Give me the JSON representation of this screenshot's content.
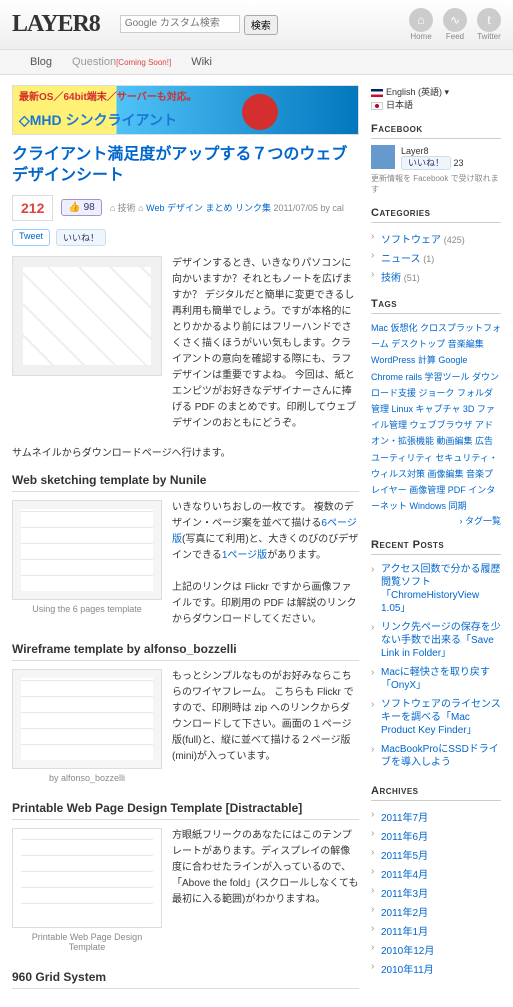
{
  "header": {
    "logo": "LAYER8",
    "search_placeholder": "Google カスタム検索",
    "search_btn": "検索",
    "icons": [
      {
        "name": "home-icon",
        "label": "Home",
        "glyph": "⌂"
      },
      {
        "name": "feed-icon",
        "label": "Feed",
        "glyph": "∿"
      },
      {
        "name": "twitter-icon",
        "label": "Twitter",
        "glyph": "t"
      }
    ]
  },
  "nav": {
    "blog": "Blog",
    "question": "Question",
    "coming_soon": "[Coming Soon!]",
    "wiki": "Wiki"
  },
  "banner": {
    "line1": "最新OS／64bit端末／サーバーも対応。",
    "line2": "◇MHD シンクライアント"
  },
  "article": {
    "title": "クライアント満足度がアップする７つのウェブデザインシート",
    "count": "212",
    "like_count": "98",
    "like_icon_label": "👍",
    "meta_prefix": "⌂ 技術 ⌂",
    "meta_link": "Web デザイン まとめ リンク集",
    "meta_date": "2011/07/05 by cal",
    "tweet": "Tweet",
    "iine": "いいね！",
    "intro": "デザインするとき、いきなりパソコンに向かいますか？それともノートを広げますか？\nデジタルだと簡単に変更できるし再利用も簡単でしょう。ですが本格的にとりかかるより前にはフリーハンドでさくさく描くほうがいい気もします。クライアントの意向を確認する際にも、ラフデザインは重要ですよね。\n今回は、紙とエンピツがお好きなデザイナーさんに捧げる PDF のまとめです。印刷してウェブデザインのおともにどうぞ。",
    "thumbnail_note": "サムネイルからダウンロードページへ行けます。"
  },
  "sections": [
    {
      "heading": "Web sketching template by Nunile",
      "caption": "Using the 6 pages template",
      "body1": "いきなりいちおしの一枚です。\n複数のデザイン・ページ案を並べて描ける",
      "link1": "6ページ版",
      "body2": "(写真にて利用)と、大きくのびのびデザインできる",
      "link2": "1ページ版",
      "body3": "があります。",
      "body4": "上記のリンクは Flickr ですから画像ファイルです。印刷用の PDF は解説のリンクからダウンロードしてください。"
    },
    {
      "heading": "Wireframe template by alfonso_bozzelli",
      "caption": "by alfonso_bozzelli",
      "body1": "もっとシンプルなものがお好みならこちらのワイヤフレーム。\nこちらも Flickr ですので、印刷時は zip へのリンクからダウンロードして下さい。画面の１ページ版(full)と、縦に並べて描ける２ページ版(mini)が入っています。"
    },
    {
      "heading": "Printable Web Page Design Template [Distractable]",
      "caption": "Printable Web Page Design Template",
      "body1": "方眼紙フリークのあなたにはこのテンプレートがあります。ディスプレイの解像度に合わせたラインが入っているので、「Above the fold」(スクロールしなくても最初に入る範囲)がわかりますね。"
    },
    {
      "heading": "960 Grid System",
      "caption": "",
      "body1": ""
    }
  ],
  "sidebar": {
    "lang_en": "English (英語)",
    "lang_jp": "日本語",
    "fb_h": "Facebook",
    "fb_name": "Layer8",
    "fb_like": "いいね！",
    "fb_count": "23",
    "fb_sub": "更新情報を Facebook で受け取れます",
    "cat_h": "Categories",
    "cats": [
      {
        "label": "ソフトウェア",
        "count": "(425)"
      },
      {
        "label": "ニュース",
        "count": "(1)"
      },
      {
        "label": "技術",
        "count": "(51)"
      }
    ],
    "tag_h": "Tags",
    "tags_html": "Mac 仮想化 クロスプラットフォーム デスクトップ 音楽編集 WordPress 計算 Google Chrome rails 学習ツール ダウンロード支援 ジョーク フォルダ管理 Linux キャプチャ 3D ファイル管理 ウェブブラウザ アドオン・拡張機能 動画編集 広告 ユーティリティ セキュリティ・ウィルス対策 画像編集 音楽プレイヤー 画像管理 PDF インターネット Windows 同期",
    "tags_more": "› タグ一覧",
    "posts_h": "Recent Posts",
    "posts": [
      "アクセス回数で分かる履歴閲覧ソフト「ChromeHistoryView 1.05」",
      "リンク先ページの保存を少ない手数で出来る「Save Link in Folder」",
      "Macに軽快さを取り戻す「OnyX」",
      "ソフトウェアのライセンスキーを調べる「Mac Product Key Finder」",
      "MacBookProにSSDドライブを導入しよう"
    ],
    "arch_h": "Archives",
    "archives": [
      "2011年7月",
      "2011年6月",
      "2011年5月",
      "2011年4月",
      "2011年3月",
      "2011年2月",
      "2011年1月",
      "2010年12月",
      "2010年11月"
    ]
  }
}
